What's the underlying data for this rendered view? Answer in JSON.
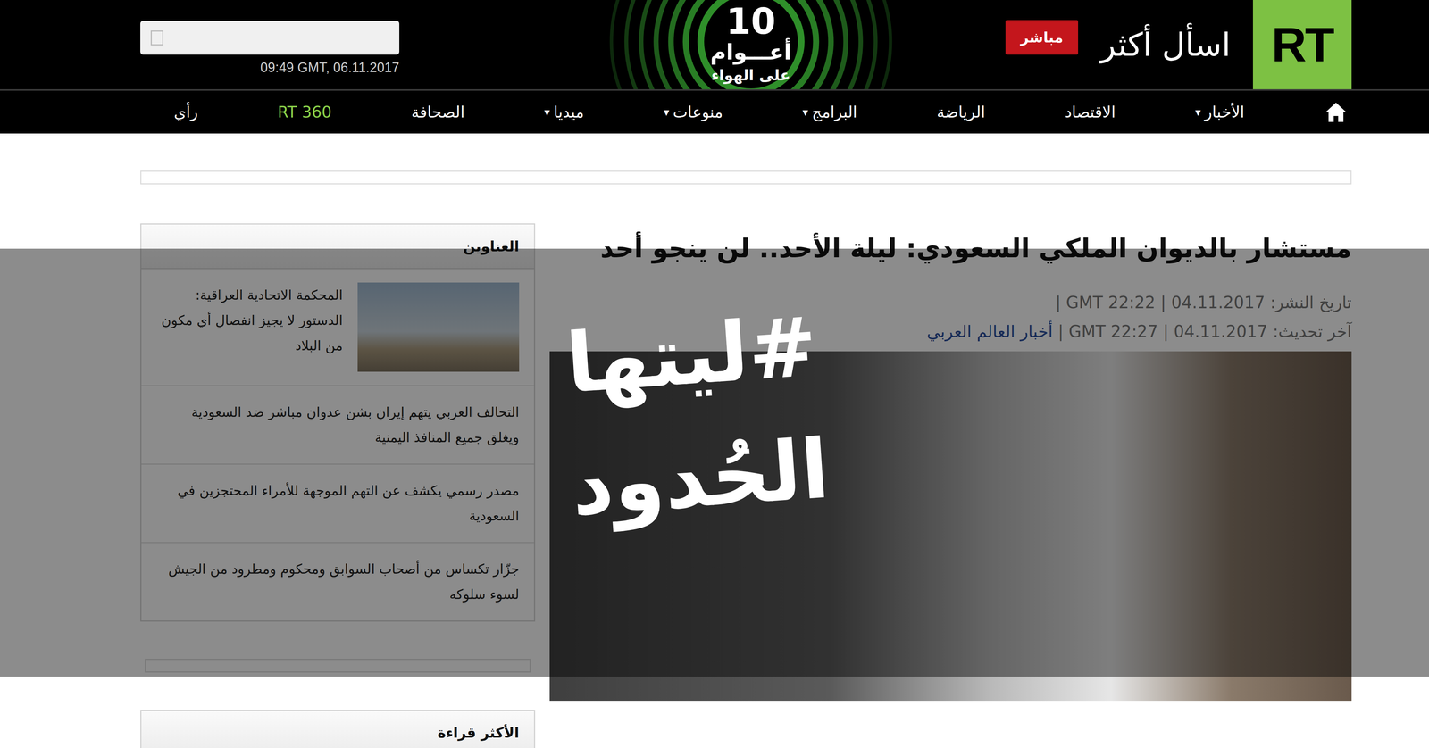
{
  "header": {
    "logo": "RT",
    "slogan": "اسأل أكثر",
    "live_badge": "مباشر",
    "anniversary": {
      "number": "10",
      "years": "أعـــوام",
      "on_air": "على الهواء"
    },
    "clock": "09:49 GMT, 06.11.2017"
  },
  "nav": [
    {
      "label": "الأخبار",
      "arrow": "▾",
      "color": "#ffffff"
    },
    {
      "label": "الاقتصاد",
      "arrow": "",
      "color": "#ffffff"
    },
    {
      "label": "الرياضة",
      "arrow": "",
      "color": "#ffffff"
    },
    {
      "label": "البرامج",
      "arrow": "▾",
      "color": "#ffffff"
    },
    {
      "label": "منوعات",
      "arrow": "▾",
      "color": "#ffffff"
    },
    {
      "label": "ميديا",
      "arrow": "▾",
      "color": "#ffffff"
    },
    {
      "label": "الصحافة",
      "arrow": "",
      "color": "#ffffff"
    },
    {
      "label": "RT 360",
      "arrow": "",
      "color": "#8bd14a"
    },
    {
      "label": "رأي",
      "arrow": "",
      "color": "#ffffff"
    }
  ],
  "article": {
    "headline": "مستشار بالديوان الملكي السعودي: ليلة الأحد.. لن ينجو أحد",
    "published": "تاريخ النشر: 04.11.2017 | GMT 22:22 |",
    "updated": "آخر تحديث: 04.11.2017 | GMT 22:27 |",
    "category": "أخبار العالم العربي"
  },
  "sidebar": {
    "title": "العناوين",
    "items": [
      {
        "text": "المحكمة الاتحادية العراقية: الدستور لا يجيز انفصال أي مكون من البلاد",
        "kind": "image"
      },
      {
        "text": "التحالف العربي يتهم إيران بشن عدوان مباشر ضد السعودية ويغلق جميع المنافذ اليمنية",
        "kind": "text"
      },
      {
        "text": "مصدر رسمي يكشف عن التهم الموجهة للأمراء المحتجزين في السعودية",
        "kind": "text"
      },
      {
        "text": "جزّار تكساس من أصحاب السوابق ومحكوم ومطرود من الجيش لسوء سلوكه",
        "kind": "text"
      }
    ]
  },
  "most_read": {
    "title": "الأكثر قراءة"
  },
  "overlay": {
    "lines": [
      "#ليتها",
      "الحُدود"
    ]
  }
}
